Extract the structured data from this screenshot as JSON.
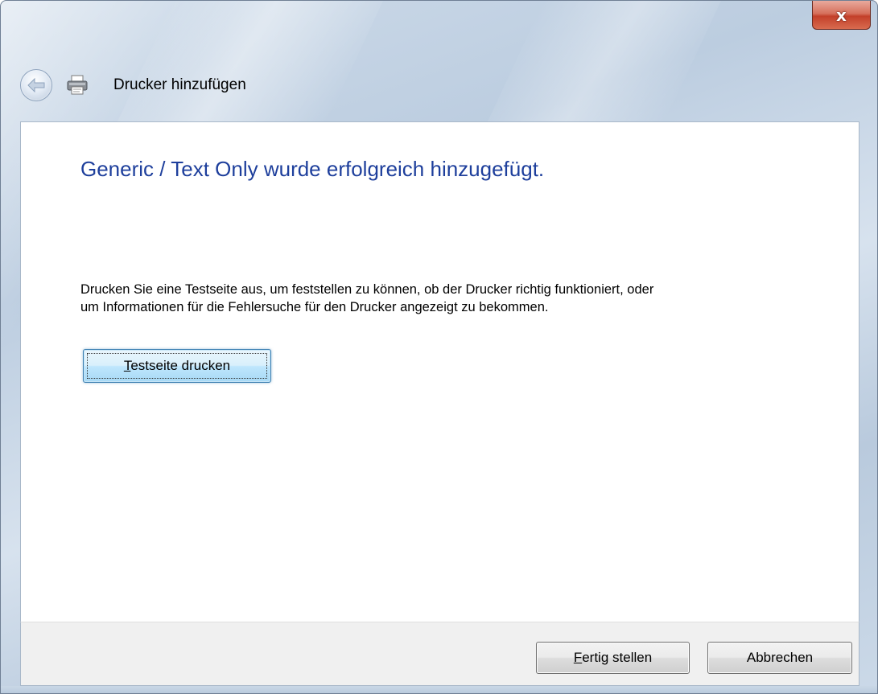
{
  "window": {
    "title": "Drucker hinzufügen",
    "close_glyph": "x"
  },
  "icons": {
    "back": "back-arrow-icon",
    "printer": "printer-icon"
  },
  "content": {
    "headline": "Generic / Text Only wurde erfolgreich hinzugefügt.",
    "description_line1": "Drucken Sie eine Testseite aus, um feststellen zu können, ob der Drucker richtig funktioniert, oder",
    "description_line2": "um Informationen für die Fehlersuche für den Drucker angezeigt zu bekommen.",
    "test_page_button": {
      "mnemonic": "T",
      "rest": "estseite drucken"
    }
  },
  "footer": {
    "finish_button": {
      "mnemonic": "F",
      "rest": "ertig stellen"
    },
    "cancel_button": "Abbrechen"
  },
  "colors": {
    "headline": "#1e3f9c",
    "close_button": "#c3402a",
    "focused_button_border": "#3c7fb1"
  }
}
